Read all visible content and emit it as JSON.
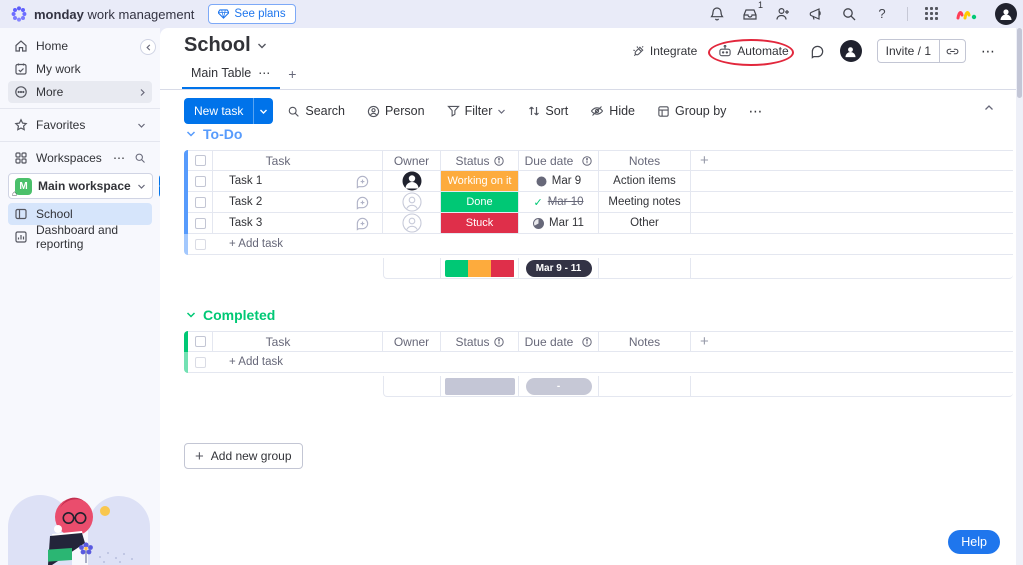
{
  "topbar": {
    "brand_bold": "monday",
    "brand_rest": "work management",
    "see_plans_label": "See plans",
    "inbox_badge": "1",
    "help_glyph": "?"
  },
  "sidebar": {
    "items": [
      {
        "label": "Home"
      },
      {
        "label": "My work"
      },
      {
        "label": "More"
      }
    ],
    "favorites_label": "Favorites",
    "workspaces_label": "Workspaces",
    "workspace": {
      "name": "Main workspace",
      "initial": "M"
    },
    "boards": [
      {
        "label": "School"
      },
      {
        "label": "Dashboard and reporting"
      }
    ]
  },
  "header": {
    "title": "School",
    "integrate_label": "Integrate",
    "automate_label": "Automate",
    "invite_label": "Invite / 1",
    "tab_label": "Main Table"
  },
  "toolbar": {
    "new_task_label": "New task",
    "search_label": "Search",
    "person_label": "Person",
    "filter_label": "Filter",
    "sort_label": "Sort",
    "hide_label": "Hide",
    "group_by_label": "Group by"
  },
  "table": {
    "columns": {
      "task": "Task",
      "owner": "Owner",
      "status": "Status",
      "due": "Due date",
      "notes": "Notes",
      "add": "+"
    }
  },
  "groups": [
    {
      "name": "To-Do",
      "color": "#579bfc",
      "add_task_label": "+ Add task",
      "tasks": [
        {
          "name": "Task 1",
          "status": "Working on it",
          "status_color": "#fdab3d",
          "due": "Mar 9",
          "notes": "Action items"
        },
        {
          "name": "Task 2",
          "status": "Done",
          "status_color": "#00c875",
          "due": "Mar 10",
          "notes": "Meeting notes"
        },
        {
          "name": "Task 3",
          "status": "Stuck",
          "status_color": "#df2f4a",
          "due": "Mar 11",
          "notes": "Other"
        }
      ],
      "summary": {
        "bar": [
          "#00c875",
          "#fdab3d",
          "#df2f4a"
        ],
        "date_range": "Mar 9 - 11"
      }
    },
    {
      "name": "Completed",
      "color": "#00c875",
      "add_task_label": "+ Add task",
      "tasks": [],
      "summary": {
        "bar": [
          "#c4c6d6"
        ],
        "date_range": "-"
      }
    }
  ],
  "footer": {
    "add_new_group_label": "Add new group",
    "help_label": "Help"
  },
  "colors": {
    "primary": "#0073ea",
    "working": "#fdab3d",
    "done": "#00c875",
    "stuck": "#df2f4a"
  }
}
